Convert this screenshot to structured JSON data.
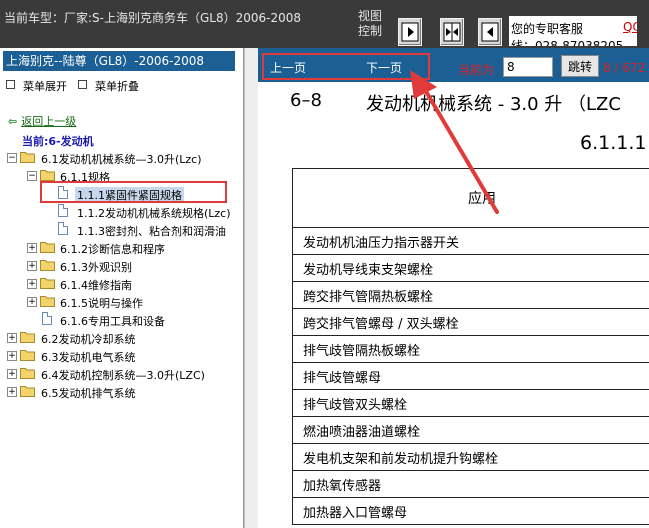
{
  "header": {
    "vehicle_text": "当前车型：厂家:S-上海别克商务车（GL8）2006-2008",
    "view_control_label": "视图控制",
    "nav_buttons": [
      "show-panel-icon",
      "split-view-icon",
      "hide-panel-icon"
    ],
    "help_text": "您的专职客服",
    "qq_link": "QQ:19",
    "tel_text": "线：028-87038205"
  },
  "sidebar": {
    "title": "上海别克--陆尊（GL8）-2006-2008",
    "expand_menu": "菜单展开",
    "collapse_menu": "菜单折叠",
    "back_link": "返回上一级",
    "current": "当前:6-发动机",
    "tree": [
      {
        "label": "6.1发动机机械系统—3.0升(Lzc)",
        "type": "folder",
        "expander": "−"
      },
      {
        "label": "6.1.1规格",
        "type": "folder",
        "expander": "−"
      },
      {
        "label": "1.1.1紧固件紧固规格",
        "type": "doc",
        "selected": true
      },
      {
        "label": "1.1.2发动机机械系统规格(Lzc)",
        "type": "doc"
      },
      {
        "label": "1.1.3密封剂、粘合剂和润滑油",
        "type": "doc"
      },
      {
        "label": "6.1.2诊断信息和程序",
        "type": "folder",
        "expander": "+"
      },
      {
        "label": "6.1.3外观识别",
        "type": "folder",
        "expander": "+"
      },
      {
        "label": "6.1.4维修指南",
        "type": "folder",
        "expander": "+"
      },
      {
        "label": "6.1.5说明与操作",
        "type": "folder",
        "expander": "+"
      },
      {
        "label": "6.1.6专用工具和设备",
        "type": "doc"
      },
      {
        "label": "6.2发动机冷却系统",
        "type": "folder",
        "expander": "+"
      },
      {
        "label": "6.3发动机电气系统",
        "type": "folder",
        "expander": "+"
      },
      {
        "label": "6.4发动机控制系统—3.0升(LZC)",
        "type": "folder",
        "expander": "+"
      },
      {
        "label": "6.5发动机排气系统",
        "type": "folder",
        "expander": "+"
      }
    ]
  },
  "pager": {
    "prev_label": "上一页",
    "next_label": "下一页",
    "current_label": "当前为",
    "page_value": "8",
    "go_label": "跳转",
    "page_count": "8 / 672"
  },
  "document": {
    "section": "6–8",
    "heading": "发动机机械系统 - 3.0 升 （LZC",
    "subheading": "6.1.1.1",
    "table_header": "应用",
    "rows": [
      "发动机机油压力指示器开关",
      "发动机导线束支架螺栓",
      "跨交排气管隔热板螺栓",
      "跨交排气管螺母 / 双头螺栓",
      "排气歧管隔热板螺栓",
      "排气歧管螺母",
      "排气歧管双头螺栓",
      "燃油喷油器油道螺栓",
      "发电机支架和前发动机提升钩螺栓",
      "加热氧传感器",
      "加热器入口管螺母"
    ]
  },
  "colors": {
    "topbar": "#3a3a3a",
    "panel_blue": "#1c5f95",
    "highlight_red": "#e03a3a",
    "folder_yellow": "#f2d46a"
  }
}
